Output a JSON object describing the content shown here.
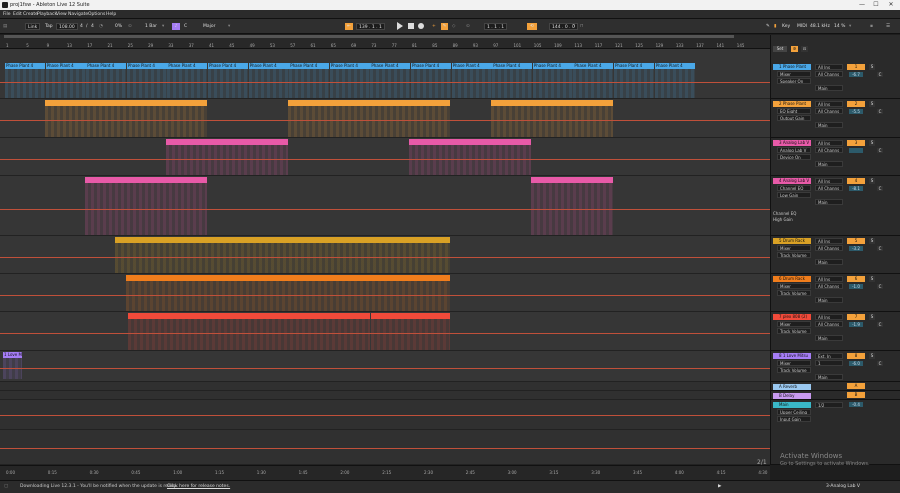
{
  "window": {
    "title": "proj1fsw - Ableton Live 12 Suite",
    "min": "—",
    "max": "☐",
    "close": "✕"
  },
  "menu": [
    "File",
    "Edit",
    "Create",
    "Playback",
    "View",
    "Navigate",
    "Options",
    "Help"
  ],
  "control": {
    "link": "Link",
    "tap": "Tap",
    "tempo": "108.00",
    "sig_num": "4",
    "sig_den": "4",
    "metro_pct": "0%",
    "quantize": "1 Bar",
    "key": "C",
    "scale": "Major",
    "pos": "139 .  1 .  1",
    "loop_start": "1 .  1 .  1",
    "loop_len": "144 .  0 .  0",
    "key_label": "Key",
    "midi_label": "MIDI",
    "cpu": "48.1 kHz",
    "zoom": "14 %"
  },
  "ruler_ticks": [
    "1",
    "5",
    "9",
    "13",
    "17",
    "21",
    "25",
    "29",
    "33",
    "37",
    "41",
    "45",
    "49",
    "53",
    "57",
    "61",
    "65",
    "69",
    "73",
    "77",
    "81",
    "85",
    "89",
    "93",
    "97",
    "101",
    "105",
    "109",
    "113",
    "117",
    "121",
    "125",
    "129",
    "133",
    "137",
    "141",
    "145"
  ],
  "time_ticks": [
    "0:00",
    "0:15",
    "0:30",
    "0:45",
    "1:00",
    "1:15",
    "1:30",
    "1:45",
    "2:00",
    "2:15",
    "2:30",
    "2:45",
    "3:00",
    "3:15",
    "3:30",
    "3:45",
    "4:00",
    "4:15",
    "4:30"
  ],
  "colors": {
    "blue": "#4aa8e8",
    "orange": "#f3a13b",
    "pink": "#e85aa8",
    "gold": "#d9a125",
    "deep_orange": "#f07d1c",
    "red": "#f04a3a",
    "violet": "#a57df5",
    "teal": "#3ab8c8"
  },
  "tracks": [
    {
      "name": "1 Phase Plant",
      "color": "#4aa8e8",
      "clips": [
        "Phase Plant 4",
        "Phase Plant 4",
        "Phase Plant 4",
        "Phase Plant 4",
        "Phase Plant 4",
        "Phase Plant 4",
        "Phase Plant 4",
        "Phase Plant 4",
        "Phase Plant 4",
        "Phase Plant 4",
        "Phase Plant 4",
        "Phase Plant 4",
        "Phase Plant 4",
        "Phase Plant 4",
        "Phase Plant 4",
        "Phase Plant 4",
        "Phase Plant 4"
      ],
      "dev": "Mixer",
      "param": "Speaker On",
      "in": "All Ins",
      "ch": "All Channs",
      "out": "Main",
      "num": "1",
      "vol": "-6.7",
      "btn": "S"
    },
    {
      "name": "2 Phase Plant",
      "color": "#f3a13b",
      "clips": [
        "",
        "",
        "",
        ""
      ],
      "dev": "EQ Eight",
      "param": "Output Gain",
      "in": "All Ins",
      "ch": "All Channs",
      "out": "Main",
      "num": "2",
      "vol": "-5.5",
      "btn": "S"
    },
    {
      "name": "3 Analog Lab V",
      "color": "#e85aa8",
      "clips": [
        "",
        ""
      ],
      "dev": "Analog Lab V",
      "param": "Device On",
      "in": "All Ins",
      "ch": "All Channs",
      "out": "Main",
      "num": "3",
      "vol": "",
      "btn": "S"
    },
    {
      "name": "4 Analog Lab V",
      "color": "#e85aa8",
      "clips": [
        "",
        ""
      ],
      "dev": "Channel EQ",
      "param": "Low Gain",
      "in": "All Ins",
      "ch": "All Channs",
      "out": "Main",
      "num": "4",
      "vol": "-8.1",
      "btn": "S",
      "extra": [
        "Channel EQ",
        "High Gain"
      ]
    },
    {
      "name": "5 Drum Rack",
      "color": "#d9a125",
      "clips": [
        ""
      ],
      "dev": "Mixer",
      "param": "Track Volume",
      "in": "All Ins",
      "ch": "All Channs",
      "out": "Main",
      "num": "5",
      "vol": "-3.2",
      "btn": "S"
    },
    {
      "name": "6 Drum Rack",
      "color": "#f07d1c",
      "clips": [
        ""
      ],
      "dev": "Mixer",
      "param": "Track Volume",
      "in": "All Ins",
      "ch": "All Channs",
      "out": "Main",
      "num": "6",
      "vol": "-1.0",
      "btn": "S"
    },
    {
      "name": "7 plex 808 (2)",
      "color": "#f04a3a",
      "clips": [
        "",
        ""
      ],
      "dev": "Mixer",
      "param": "Track Volume",
      "in": "All Ins",
      "ch": "All Channs",
      "out": "Main",
      "num": "7",
      "vol": "-1.9",
      "btn": "S"
    },
    {
      "name": "8 1 Love Mitsu",
      "color": "#a57df5",
      "clips": [
        "1 Love M"
      ],
      "dev": "Mixer",
      "param": "Track Volume",
      "in": "Ext. In",
      "ch": "1",
      "out": "Main",
      "num": "8",
      "vol": "-6.0",
      "btn": "S"
    }
  ],
  "returns": [
    {
      "name": "A Reverb",
      "color": "#9ac8f0",
      "num": "A"
    },
    {
      "name": "B Delay",
      "color": "#c89af0",
      "num": "B"
    }
  ],
  "master": {
    "name": "Main",
    "color": "#3ab8c8",
    "dev": "Upper Ceiling",
    "param": "Input Gain",
    "io": "1/2",
    "vol": "-0.4"
  },
  "set_label": "Set",
  "page_indicator": "2/1",
  "watermark": {
    "title": "Activate Windows",
    "sub": "Go to Settings to activate Windows."
  },
  "status": {
    "msg": "Downloading Live 12.3.1 - You'll be notified when the update is ready.",
    "link": "Click here for release notes.",
    "device": "3-Analog Lab V"
  }
}
